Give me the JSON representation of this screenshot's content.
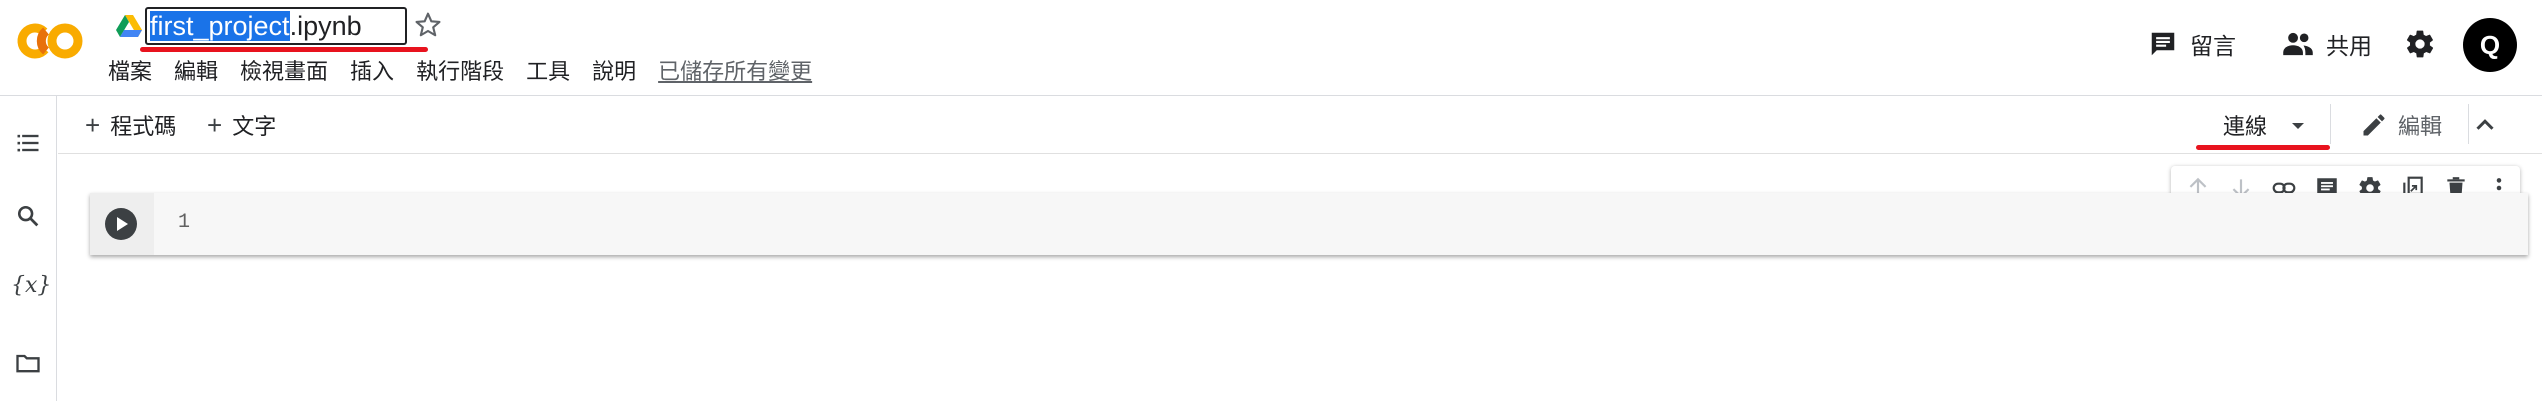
{
  "notebook": {
    "title_selected": "first_project",
    "title_rest": ".ipynb"
  },
  "menu": {
    "items": [
      "檔案",
      "編輯",
      "檢視畫面",
      "插入",
      "執行階段",
      "工具",
      "說明"
    ],
    "saved_status": "已儲存所有變更"
  },
  "header": {
    "comment_label": "留言",
    "share_label": "共用",
    "avatar_letter": "Q"
  },
  "toolbar": {
    "add_code_label": "程式碼",
    "add_text_label": "文字",
    "connect_label": "連線",
    "edit_label": "編輯"
  },
  "cell": {
    "line_number": "1"
  },
  "colors": {
    "logo_orange": "#f9ab00",
    "logo_dark_orange": "#e8710a",
    "selection_blue": "#1a73e8",
    "annotation_red": "#e8131e"
  },
  "icons": {
    "rail": [
      "table-of-contents-icon",
      "search-icon",
      "variables-icon",
      "folder-icon"
    ],
    "cell_toolbar": [
      "arrow-up-icon",
      "arrow-down-icon",
      "link-icon",
      "comment-icon",
      "gear-icon",
      "mirror-cell-icon",
      "trash-icon",
      "more-vert-icon"
    ]
  }
}
